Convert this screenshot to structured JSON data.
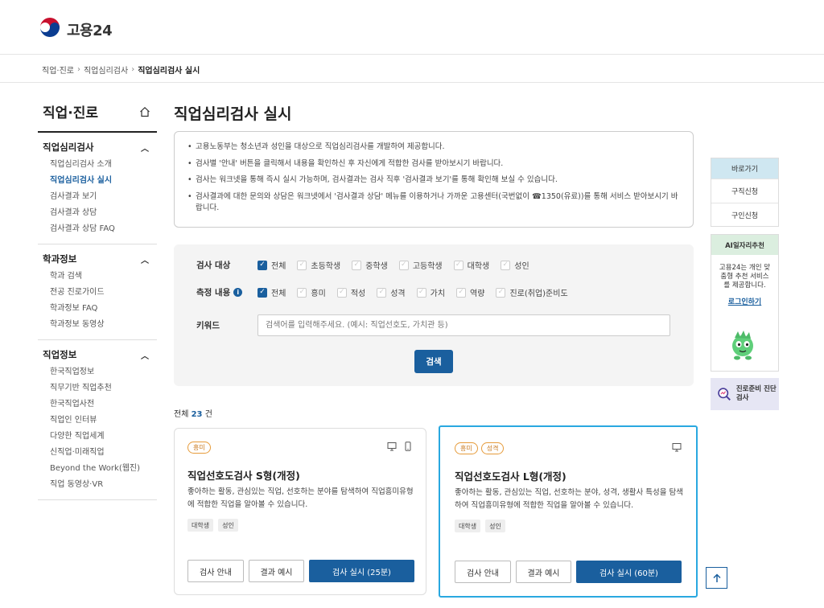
{
  "header": {
    "logo_text": "고용24"
  },
  "breadcrumb": {
    "items": [
      "직업·진로",
      "직업심리검사"
    ],
    "current": "직업심리검사 실시"
  },
  "sidebar": {
    "title": "직업·진로",
    "groups": [
      {
        "label": "직업심리검사",
        "items": [
          "직업심리검사 소개",
          "직업심리검사 실시",
          "검사결과 보기",
          "검사결과 상담",
          "검사결과 상담 FAQ"
        ]
      },
      {
        "label": "학과정보",
        "items": [
          "학과 검색",
          "전공 진로가이드",
          "학과정보 FAQ",
          "학과정보 동영상"
        ]
      },
      {
        "label": "직업정보",
        "items": [
          "한국직업정보",
          "직무기반 직업추천",
          "한국직업사전",
          "직업인 인터뷰",
          "다양한 직업세계",
          "신직업·미래직업",
          "Beyond the Work(웹진)",
          "직업 동영상·VR"
        ]
      }
    ]
  },
  "main": {
    "title": "직업심리검사 실시",
    "notice": [
      "고용노동부는 청소년과 성인을 대상으로 직업심리검사를 개발하여 제공합니다.",
      "검사별 '안내' 버튼을 클릭해서 내용을 확인하신 후 자신에게 적합한 검사를 받아보시기 바랍니다.",
      "검사는 워크넷을 통해 즉시 실시 가능하며, 검사결과는 검사 직후 '검사결과 보기'를 통해 확인해 보실 수 있습니다.",
      "검사결과에 대한 문의와 상담은 워크넷에서 '검사결과 상담' 메뉴를 이용하거나 가까운 고용센터(국번없이 ☎1350(유료))를 통해 서비스 받아보시기 바랍니다."
    ]
  },
  "filter": {
    "target_label": "검사 대상",
    "target_options": [
      {
        "label": "전체",
        "checked": true
      },
      {
        "label": "초등학생",
        "checked": false
      },
      {
        "label": "중학생",
        "checked": false
      },
      {
        "label": "고등학생",
        "checked": false
      },
      {
        "label": "대학생",
        "checked": false
      },
      {
        "label": "성인",
        "checked": false
      }
    ],
    "measure_label": "측정 내용",
    "measure_options": [
      {
        "label": "전체",
        "checked": true
      },
      {
        "label": "흥미",
        "checked": false
      },
      {
        "label": "적성",
        "checked": false
      },
      {
        "label": "성격",
        "checked": false
      },
      {
        "label": "가치",
        "checked": false
      },
      {
        "label": "역량",
        "checked": false
      },
      {
        "label": "진로(취업)준비도",
        "checked": false
      }
    ],
    "keyword_label": "키워드",
    "keyword_placeholder": "검색어를 입력해주세요. (예시: 직업선호도, 가치관 등)",
    "search_label": "검색"
  },
  "results": {
    "prefix": "전체",
    "count": "23",
    "suffix": "건"
  },
  "cards": [
    {
      "tags": [
        "흥미"
      ],
      "devices": [
        "pc-icon",
        "mobile-icon"
      ],
      "title": "직업선호도검사 S형(개정)",
      "desc": "좋아하는 활동, 관심있는 직업, 선호하는 분야를 탐색하여 직업흥미유형에 적합한 직업을 알아볼 수 있습니다.",
      "chips": [
        "대학생",
        "성인"
      ],
      "btn_guide": "검사 안내",
      "btn_example": "결과 예시",
      "btn_start": "검사 실시 (25분)"
    },
    {
      "tags": [
        "흥미",
        "성격"
      ],
      "devices": [
        "pc-icon"
      ],
      "title": "직업선호도검사 L형(개정)",
      "desc": "좋아하는 활동, 관심있는 직업, 선호하는 분야, 성격, 생활사 특성을 탐색하여 직업흥미유형에 적합한 직업을 알아볼 수 있습니다.",
      "chips": [
        "대학생",
        "성인"
      ],
      "btn_guide": "검사 안내",
      "btn_example": "결과 예시",
      "btn_start": "검사 실시 (60분)"
    }
  ],
  "right_rail": {
    "quick_title": "바로가기",
    "quick_items": [
      "구직신청",
      "구인신청"
    ],
    "ai_title": "AI일자리추천",
    "ai_desc": "고용24는 개인 맞춤형 추천 서비스를 제공합니다.",
    "ai_link": "로그인하기",
    "diag_text": "진로준비 진단검사"
  },
  "colors": {
    "primary": "#1a5f9e",
    "tag": "#e69b3a",
    "selected_border": "#29a8e0"
  }
}
